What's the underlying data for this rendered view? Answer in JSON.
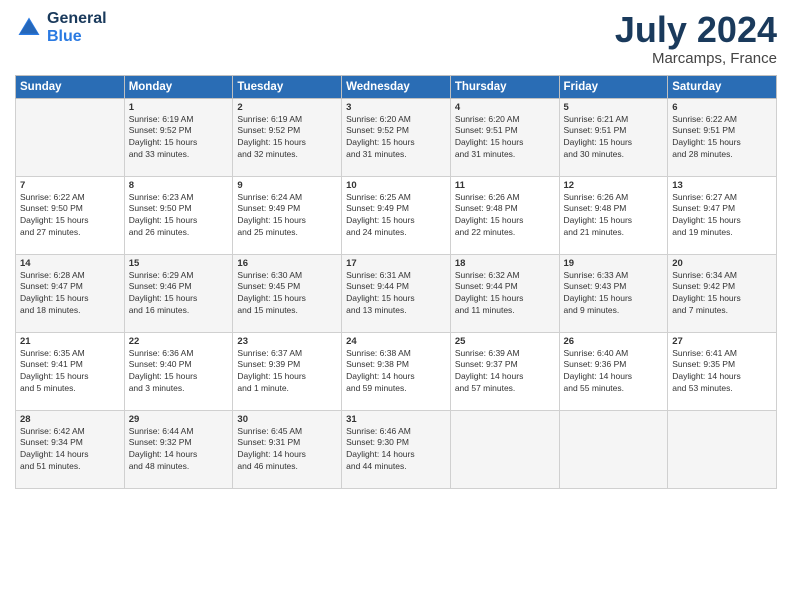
{
  "logo": {
    "line1": "General",
    "line2": "Blue"
  },
  "title": "July 2024",
  "location": "Marcamps, France",
  "days_header": [
    "Sunday",
    "Monday",
    "Tuesday",
    "Wednesday",
    "Thursday",
    "Friday",
    "Saturday"
  ],
  "weeks": [
    [
      {
        "day": "",
        "info": ""
      },
      {
        "day": "1",
        "info": "Sunrise: 6:19 AM\nSunset: 9:52 PM\nDaylight: 15 hours\nand 33 minutes."
      },
      {
        "day": "2",
        "info": "Sunrise: 6:19 AM\nSunset: 9:52 PM\nDaylight: 15 hours\nand 32 minutes."
      },
      {
        "day": "3",
        "info": "Sunrise: 6:20 AM\nSunset: 9:52 PM\nDaylight: 15 hours\nand 31 minutes."
      },
      {
        "day": "4",
        "info": "Sunrise: 6:20 AM\nSunset: 9:51 PM\nDaylight: 15 hours\nand 31 minutes."
      },
      {
        "day": "5",
        "info": "Sunrise: 6:21 AM\nSunset: 9:51 PM\nDaylight: 15 hours\nand 30 minutes."
      },
      {
        "day": "6",
        "info": "Sunrise: 6:22 AM\nSunset: 9:51 PM\nDaylight: 15 hours\nand 28 minutes."
      }
    ],
    [
      {
        "day": "7",
        "info": "Sunrise: 6:22 AM\nSunset: 9:50 PM\nDaylight: 15 hours\nand 27 minutes."
      },
      {
        "day": "8",
        "info": "Sunrise: 6:23 AM\nSunset: 9:50 PM\nDaylight: 15 hours\nand 26 minutes."
      },
      {
        "day": "9",
        "info": "Sunrise: 6:24 AM\nSunset: 9:49 PM\nDaylight: 15 hours\nand 25 minutes."
      },
      {
        "day": "10",
        "info": "Sunrise: 6:25 AM\nSunset: 9:49 PM\nDaylight: 15 hours\nand 24 minutes."
      },
      {
        "day": "11",
        "info": "Sunrise: 6:26 AM\nSunset: 9:48 PM\nDaylight: 15 hours\nand 22 minutes."
      },
      {
        "day": "12",
        "info": "Sunrise: 6:26 AM\nSunset: 9:48 PM\nDaylight: 15 hours\nand 21 minutes."
      },
      {
        "day": "13",
        "info": "Sunrise: 6:27 AM\nSunset: 9:47 PM\nDaylight: 15 hours\nand 19 minutes."
      }
    ],
    [
      {
        "day": "14",
        "info": "Sunrise: 6:28 AM\nSunset: 9:47 PM\nDaylight: 15 hours\nand 18 minutes."
      },
      {
        "day": "15",
        "info": "Sunrise: 6:29 AM\nSunset: 9:46 PM\nDaylight: 15 hours\nand 16 minutes."
      },
      {
        "day": "16",
        "info": "Sunrise: 6:30 AM\nSunset: 9:45 PM\nDaylight: 15 hours\nand 15 minutes."
      },
      {
        "day": "17",
        "info": "Sunrise: 6:31 AM\nSunset: 9:44 PM\nDaylight: 15 hours\nand 13 minutes."
      },
      {
        "day": "18",
        "info": "Sunrise: 6:32 AM\nSunset: 9:44 PM\nDaylight: 15 hours\nand 11 minutes."
      },
      {
        "day": "19",
        "info": "Sunrise: 6:33 AM\nSunset: 9:43 PM\nDaylight: 15 hours\nand 9 minutes."
      },
      {
        "day": "20",
        "info": "Sunrise: 6:34 AM\nSunset: 9:42 PM\nDaylight: 15 hours\nand 7 minutes."
      }
    ],
    [
      {
        "day": "21",
        "info": "Sunrise: 6:35 AM\nSunset: 9:41 PM\nDaylight: 15 hours\nand 5 minutes."
      },
      {
        "day": "22",
        "info": "Sunrise: 6:36 AM\nSunset: 9:40 PM\nDaylight: 15 hours\nand 3 minutes."
      },
      {
        "day": "23",
        "info": "Sunrise: 6:37 AM\nSunset: 9:39 PM\nDaylight: 15 hours\nand 1 minute."
      },
      {
        "day": "24",
        "info": "Sunrise: 6:38 AM\nSunset: 9:38 PM\nDaylight: 14 hours\nand 59 minutes."
      },
      {
        "day": "25",
        "info": "Sunrise: 6:39 AM\nSunset: 9:37 PM\nDaylight: 14 hours\nand 57 minutes."
      },
      {
        "day": "26",
        "info": "Sunrise: 6:40 AM\nSunset: 9:36 PM\nDaylight: 14 hours\nand 55 minutes."
      },
      {
        "day": "27",
        "info": "Sunrise: 6:41 AM\nSunset: 9:35 PM\nDaylight: 14 hours\nand 53 minutes."
      }
    ],
    [
      {
        "day": "28",
        "info": "Sunrise: 6:42 AM\nSunset: 9:34 PM\nDaylight: 14 hours\nand 51 minutes."
      },
      {
        "day": "29",
        "info": "Sunrise: 6:44 AM\nSunset: 9:32 PM\nDaylight: 14 hours\nand 48 minutes."
      },
      {
        "day": "30",
        "info": "Sunrise: 6:45 AM\nSunset: 9:31 PM\nDaylight: 14 hours\nand 46 minutes."
      },
      {
        "day": "31",
        "info": "Sunrise: 6:46 AM\nSunset: 9:30 PM\nDaylight: 14 hours\nand 44 minutes."
      },
      {
        "day": "",
        "info": ""
      },
      {
        "day": "",
        "info": ""
      },
      {
        "day": "",
        "info": ""
      }
    ]
  ]
}
